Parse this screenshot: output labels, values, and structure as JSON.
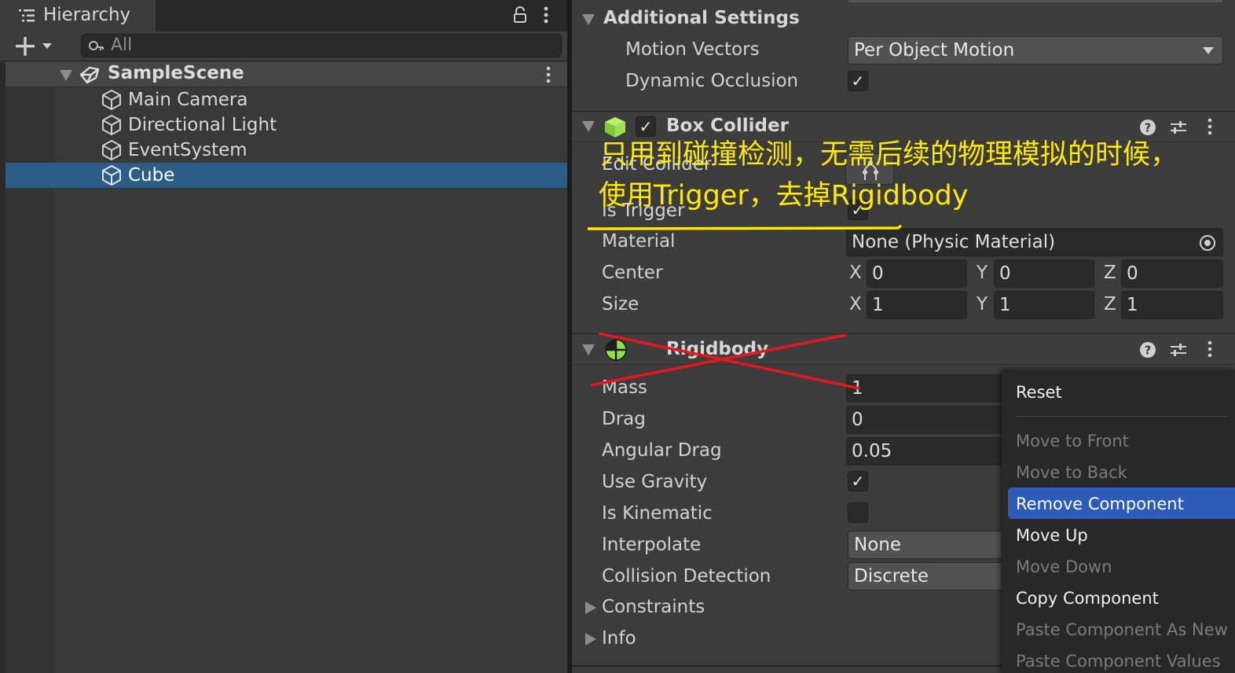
{
  "hierarchy": {
    "title": "Hierarchy",
    "search_placeholder": "All",
    "scene": "SampleScene",
    "items": [
      "Main Camera",
      "Directional Light",
      "EventSystem",
      "Cube"
    ],
    "selected": "Cube"
  },
  "inspector": {
    "additional_settings": {
      "title": "Additional Settings",
      "motion_vectors_label": "Motion Vectors",
      "motion_vectors_value": "Per Object Motion",
      "dynamic_occlusion_label": "Dynamic Occlusion",
      "dynamic_occlusion_checked": true
    },
    "box_collider": {
      "title": "Box Collider",
      "enabled": true,
      "edit_collider_label": "Edit Collider",
      "is_trigger_label": "Is Trigger",
      "is_trigger_checked": true,
      "material_label": "Material",
      "material_value": "None (Physic Material)",
      "center_label": "Center",
      "center": {
        "x": "0",
        "y": "0",
        "z": "0"
      },
      "size_label": "Size",
      "size": {
        "x": "1",
        "y": "1",
        "z": "1"
      },
      "axis_x": "X",
      "axis_y": "Y",
      "axis_z": "Z"
    },
    "rigidbody": {
      "title": "Rigidbody",
      "mass_label": "Mass",
      "mass_value": "1",
      "drag_label": "Drag",
      "drag_value": "0",
      "angular_drag_label": "Angular Drag",
      "angular_drag_value": "0.05",
      "use_gravity_label": "Use Gravity",
      "use_gravity_checked": true,
      "is_kinematic_label": "Is Kinematic",
      "is_kinematic_checked": false,
      "interpolate_label": "Interpolate",
      "interpolate_value": "None",
      "collision_detection_label": "Collision Detection",
      "collision_detection_value": "Discrete",
      "constraints_label": "Constraints",
      "info_label": "Info"
    }
  },
  "context_menu": {
    "items": [
      {
        "label": "Reset",
        "enabled": true
      },
      {
        "label": "Move to Front",
        "enabled": false
      },
      {
        "label": "Move to Back",
        "enabled": false
      },
      {
        "label": "Remove Component",
        "enabled": true,
        "highlighted": true
      },
      {
        "label": "Move Up",
        "enabled": true
      },
      {
        "label": "Move Down",
        "enabled": false
      },
      {
        "label": "Copy Component",
        "enabled": true
      },
      {
        "label": "Paste Component As New",
        "enabled": false
      },
      {
        "label": "Paste Component Values",
        "enabled": false
      }
    ]
  },
  "annotation": {
    "line1": "只用到碰撞检测，无需后续的物理模拟的时候，",
    "line2": "使用Trigger，去掉Rigidbody",
    "text_color": "#ffea00",
    "strike_color": "#e8161e"
  },
  "icons": {
    "hierarchy_tab": "list-icon",
    "add": "plus-icon",
    "lock": "lock-icon",
    "menu": "kebab-icon",
    "search": "search-icon",
    "scene": "unity-logo-icon",
    "gameobject": "cube-icon",
    "help": "help-icon",
    "presets": "sliders-icon",
    "box_collider": "green-cube-icon",
    "rigidbody": "rigidbody-icon",
    "object_picker": "target-icon"
  },
  "colors": {
    "selection": "#2c5d87",
    "menu_highlight": "#2c5cb8",
    "panel": "#383838"
  }
}
